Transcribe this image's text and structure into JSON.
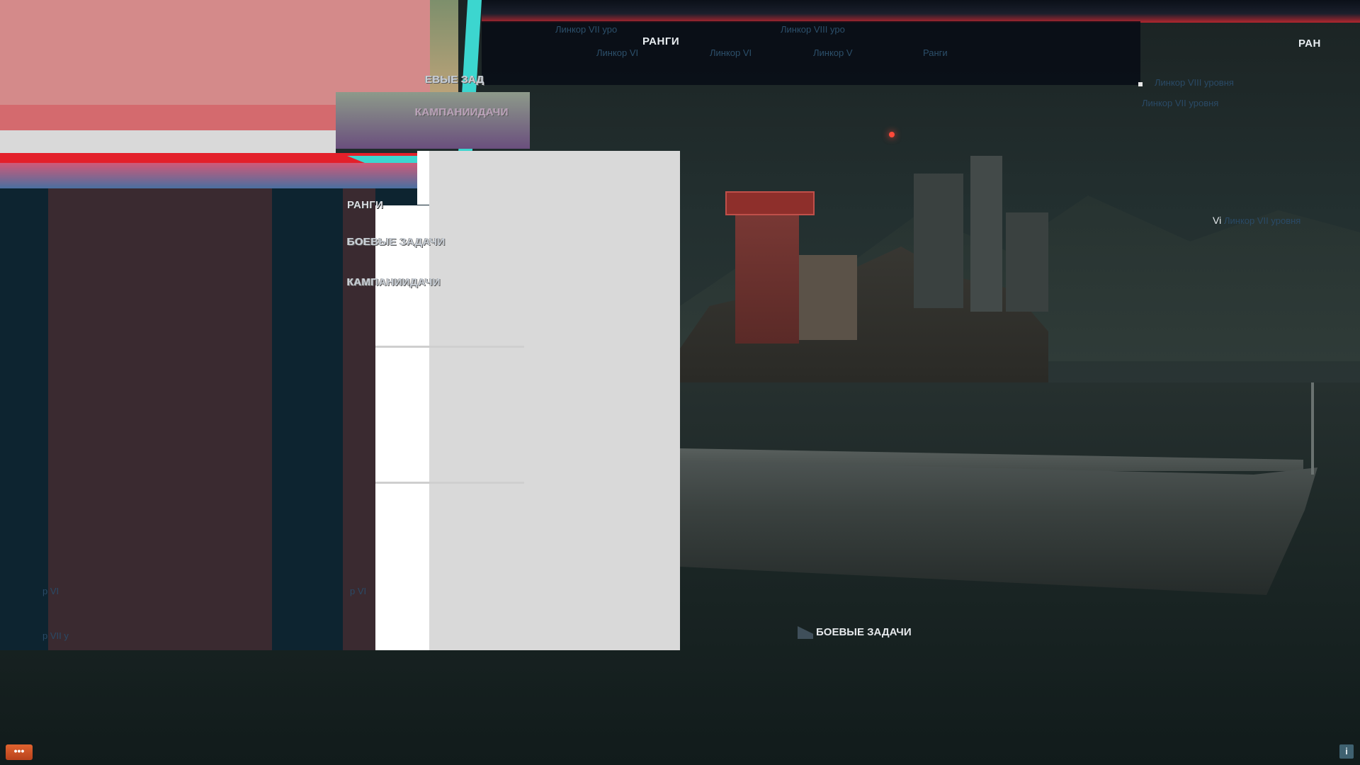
{
  "header": {
    "tab_ranks": "РАНГИ",
    "tab_ranks_right": "РАН",
    "subtabs": [
      "Линкор VII уро",
      "Линкор VI",
      "Линкор V",
      "Ранги",
      "Линкор VIII уро",
      "Линкор VII уро"
    ]
  },
  "menu": {
    "glitch_combat": "ЕВЫЕ ЗАД",
    "glitch_campaign": "КАМПАНИИДАЧИ",
    "ranks": "РАНГИ",
    "combat_missions": "БОЕВЫЕ ЗАДАЧИ",
    "campaigns": "КАМПАНИИДАЧИ"
  },
  "right_panel": {
    "line1": "Линкор VIII уровня",
    "line2": "Линкор VII уровня",
    "vi_prefix": "Vi",
    "vi_text": "Линкор VII уровня"
  },
  "left_panel": {
    "ghost1": "р VI",
    "ghost2": "р VII у",
    "ghost3": "р VI"
  },
  "hero": {
    "combat_label": "БОЕВЫЕ ЗАДАЧИ"
  },
  "footer": {
    "chat_label": "•••",
    "info_label": "i"
  },
  "colors": {
    "accent_red": "#e3202a",
    "accent_cyan": "#3cd6cf",
    "panel_grey": "#d9d9d9",
    "pink": "#d48a8a"
  }
}
